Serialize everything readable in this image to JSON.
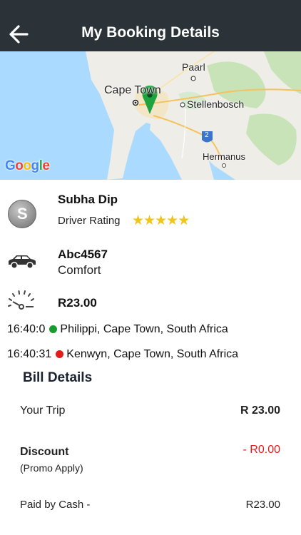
{
  "header": {
    "title": "My Booking Details",
    "back_icon": "back-arrow-icon",
    "background": "#2b3338"
  },
  "map": {
    "labels": {
      "paarl": "Paarl",
      "cape_town": "Cape Town",
      "stellenbosch": "Stellenbosch",
      "hermanus": "Hermanus",
      "route": "2"
    },
    "attribution": "Google",
    "marker_color": "#1fa341"
  },
  "driver": {
    "name": "Subha Dip",
    "rating_label": "Driver Rating",
    "stars": 5,
    "avatar_initial": "S"
  },
  "vehicle": {
    "plate": "Abc4567",
    "type": "Comfort"
  },
  "fare": {
    "amount": "R23.00"
  },
  "stops": [
    {
      "time": "16:40:0",
      "address": "Philippi, Cape Town, South Africa",
      "color": "#1a9b2e"
    },
    {
      "time": "16:40:31",
      "address": "Kenwyn, Cape Town, South Africa",
      "color": "#e31b1b"
    }
  ],
  "bill": {
    "title": "Bill Details",
    "your_trip_label": "Your Trip",
    "your_trip_value": "R 23.00",
    "discount_label": "Discount",
    "discount_sub": "(Promo Apply)",
    "discount_value": "- R0.00",
    "paid_label": "Paid by Cash -",
    "paid_value": "R23.00"
  },
  "colors": {
    "accent_red": "#e21b1b",
    "star_gold": "#f0c419"
  }
}
